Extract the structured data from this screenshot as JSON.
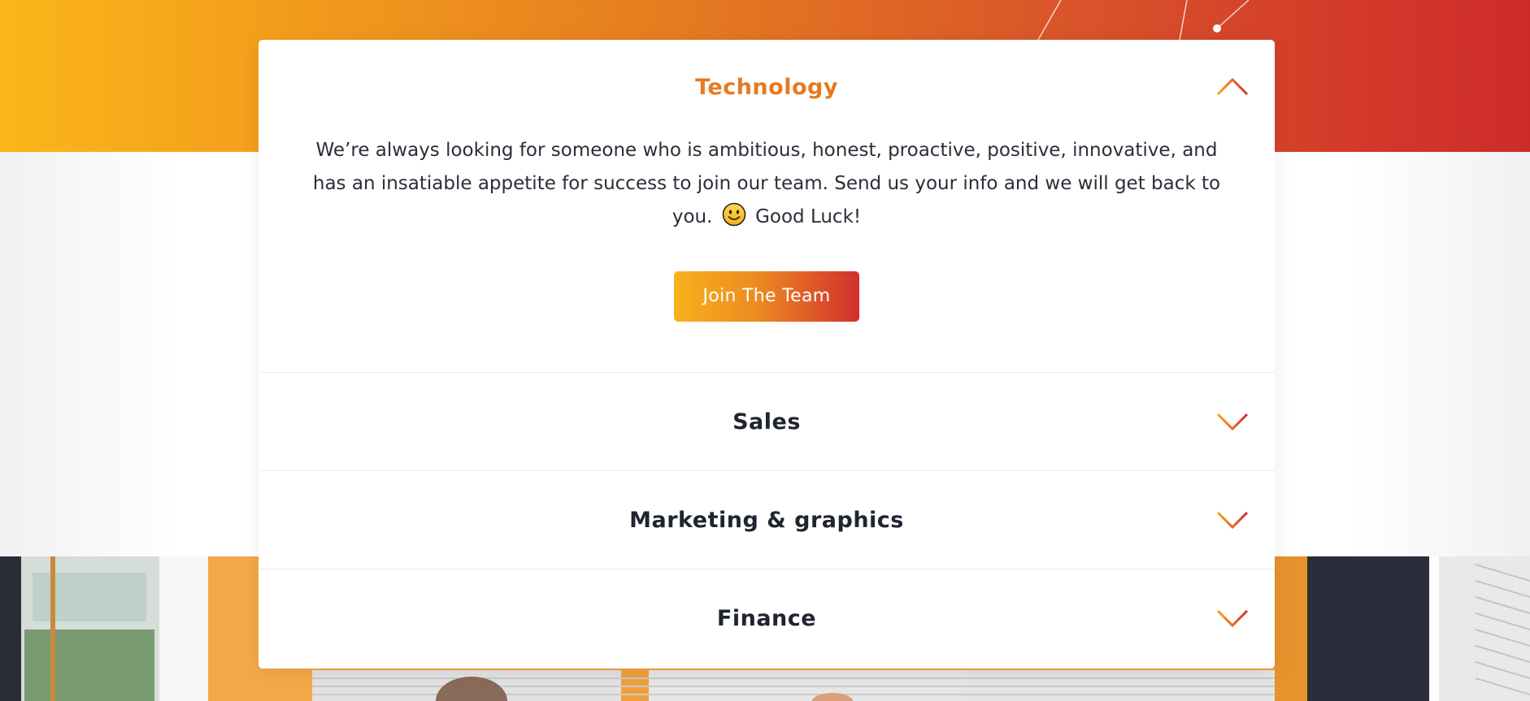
{
  "colors": {
    "brand_start": "#fbb61a",
    "brand_end": "#cf2a2a",
    "active_title": "#e57a1f",
    "text_dark": "#1f2430"
  },
  "accordion": {
    "items": [
      {
        "title": "Technology",
        "expanded": true,
        "chevron_icon": "chevron-up-icon",
        "body": {
          "text_before_emoji": "We’re always looking for someone who is ambitious, honest, proactive, positive, innovative, and has an insatiable appetite for success to join our team. Send us your info and we will get back to you.",
          "emoji": "smiley-icon",
          "text_after_emoji": "Good Luck!",
          "button_label": "Join The Team"
        }
      },
      {
        "title": "Sales",
        "expanded": false,
        "chevron_icon": "chevron-down-icon"
      },
      {
        "title": "Marketing & graphics",
        "expanded": false,
        "chevron_icon": "chevron-down-icon"
      },
      {
        "title": "Finance",
        "expanded": false,
        "chevron_icon": "chevron-down-icon"
      }
    ]
  }
}
